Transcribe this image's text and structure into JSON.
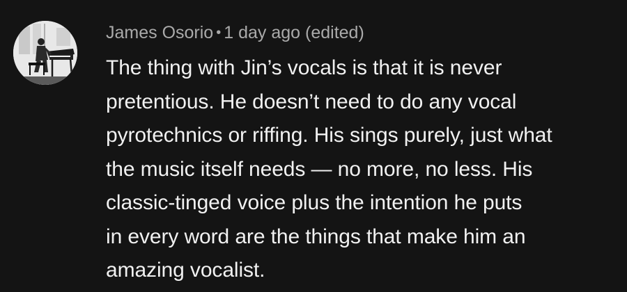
{
  "comment": {
    "avatar_icon": "profile-photo-person-at-piano",
    "author": "James Osorio",
    "separator": "•",
    "timestamp": "1 day ago",
    "edited_label": "(edited)",
    "lines": [
      "The thing with Jin’s vocals is that it is never",
      "pretentious. He doesn’t need to do any vocal",
      "pyrotechnics or riffing. His sings purely, just what",
      "the music itself needs — no more, no less. His",
      "classic-tinged voice plus the intention he puts",
      "in every word are the things that make him an",
      "amazing vocalist."
    ]
  },
  "colors": {
    "background": "#141414",
    "meta_text": "#aaaaaa",
    "body_text": "#f1f1f1"
  }
}
